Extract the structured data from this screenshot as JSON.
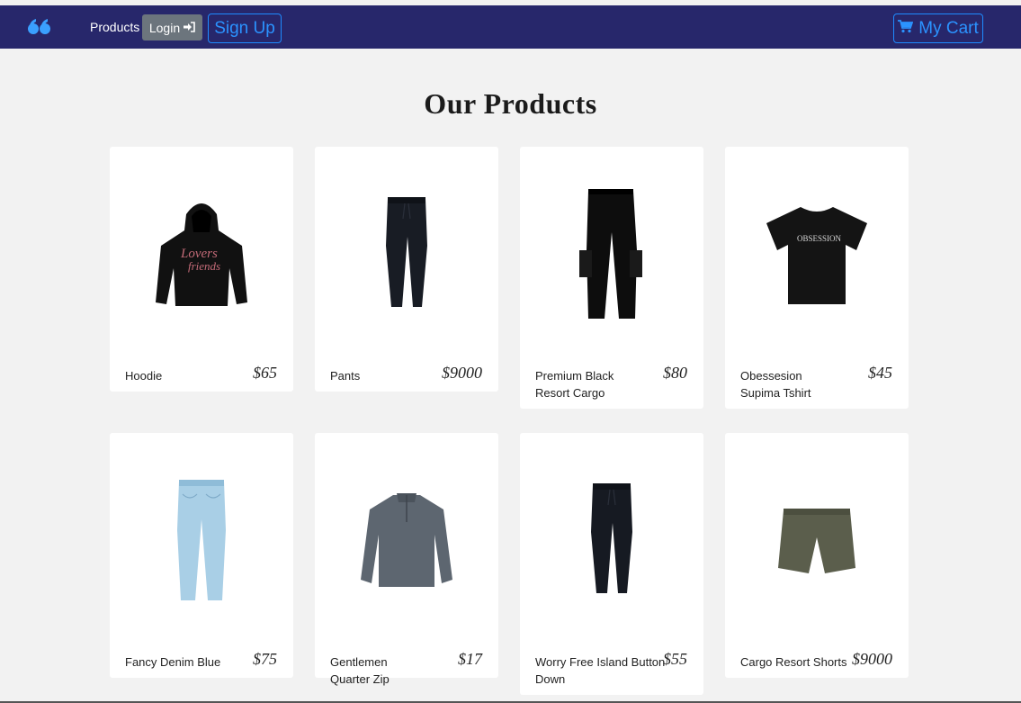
{
  "colors": {
    "navbar": "#27276b",
    "accent": "#2b93ff",
    "login_bg": "#6c757d",
    "page_bg": "#f2f2f2"
  },
  "navbar": {
    "logo_icon": "quote-icon",
    "products_label": "Products",
    "login_label": "Login",
    "login_icon": "sign-in-icon",
    "signup_label": "Sign Up",
    "cart_label": "My Cart",
    "cart_icon": "cart-icon"
  },
  "main": {
    "title": "Our Products",
    "products": [
      {
        "name": "Hoodie",
        "price": "$65",
        "image": "hoodie-image"
      },
      {
        "name": "Pants",
        "price": "$9000",
        "image": "pants-image"
      },
      {
        "name": "Premium Black Resort Cargo",
        "price": "$80",
        "image": "cargo-pants-image"
      },
      {
        "name": "Obessesion Supima Tshirt",
        "price": "$45",
        "image": "tshirt-image"
      },
      {
        "name": "Fancy Denim Blue",
        "price": "$75",
        "image": "denim-jeans-image"
      },
      {
        "name": "Gentlemen Quarter Zip",
        "price": "$17",
        "image": "quarter-zip-image"
      },
      {
        "name": "Worry Free Island Button Down",
        "price": "$55",
        "image": "pants-image"
      },
      {
        "name": "Cargo Resort Shorts",
        "price": "$9000",
        "image": "shorts-image"
      }
    ]
  }
}
